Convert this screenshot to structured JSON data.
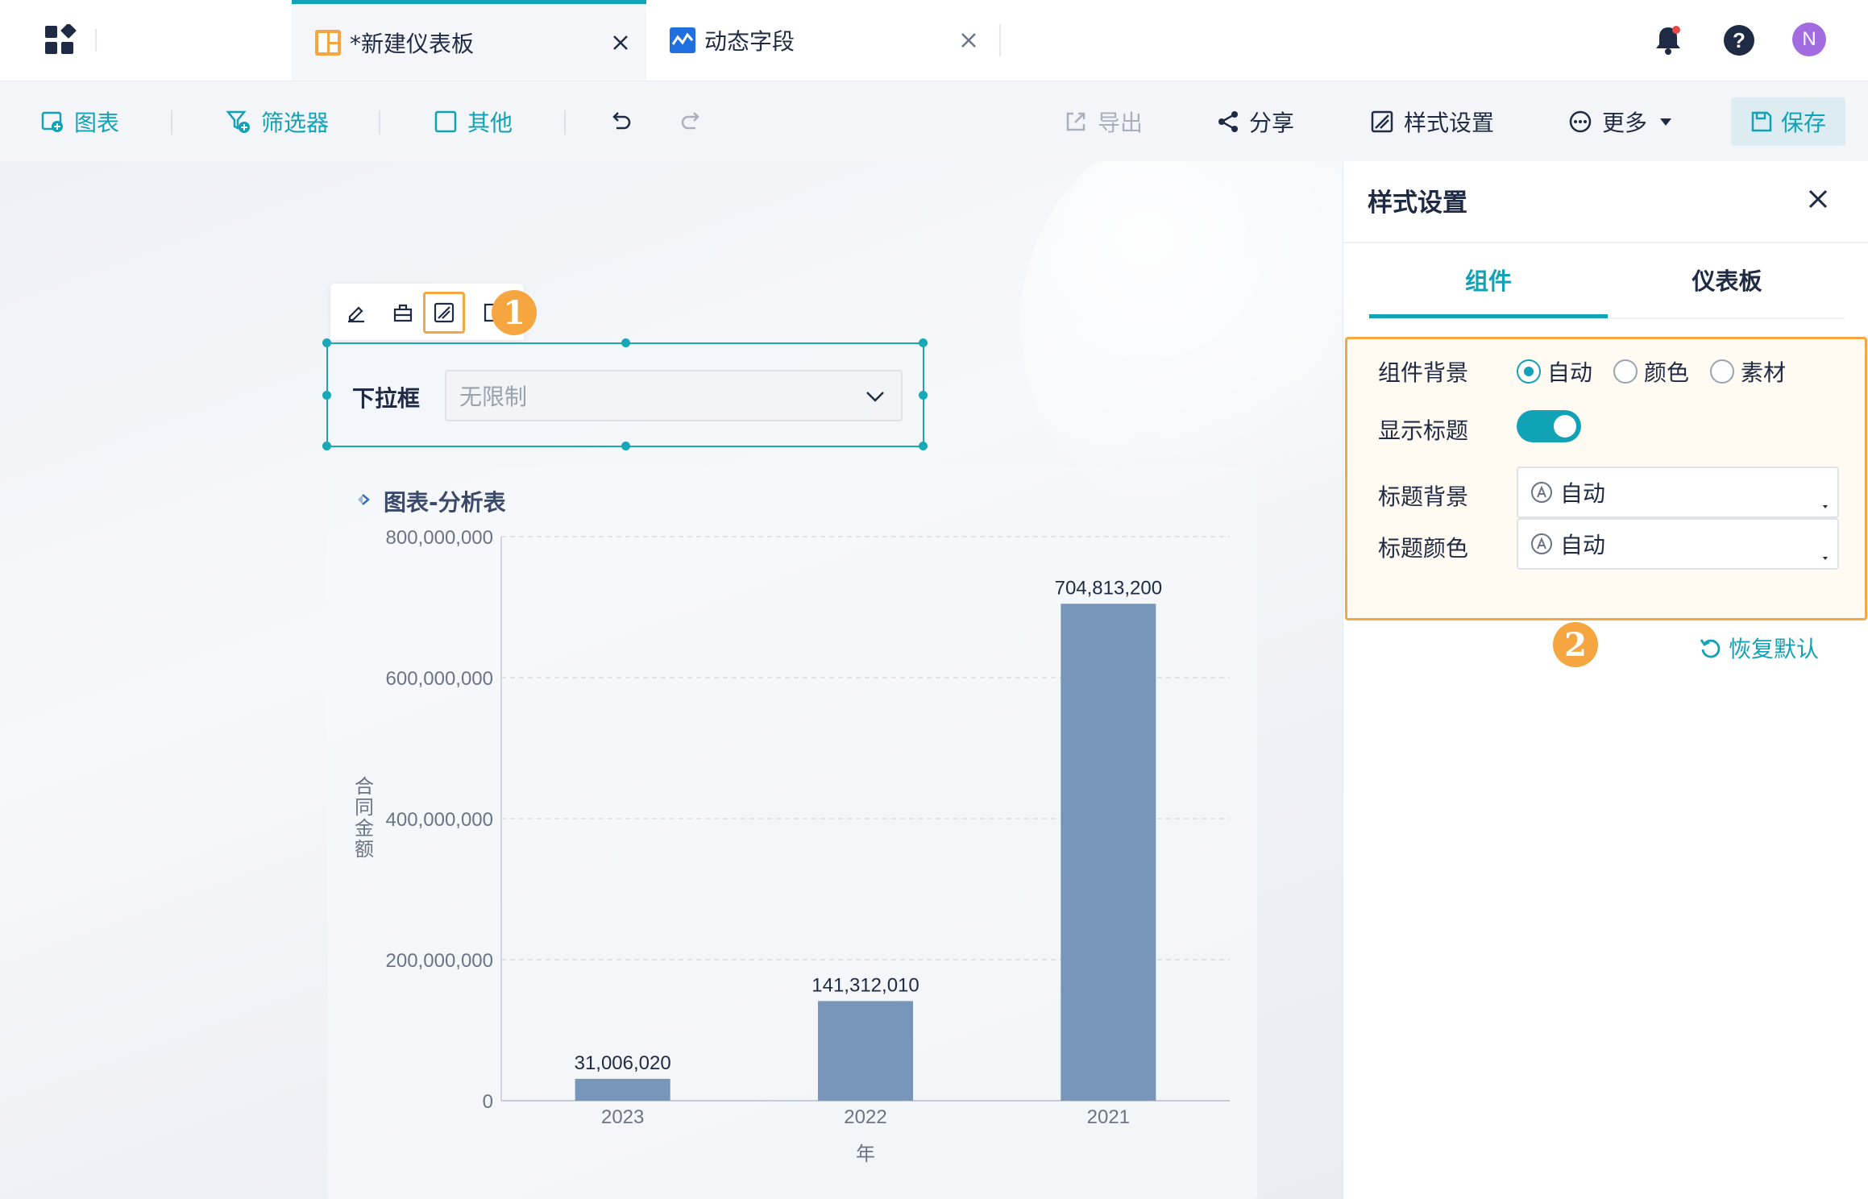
{
  "top_tabs": [
    {
      "label": "*新建仪表板"
    },
    {
      "label": "动态字段"
    }
  ],
  "avatar_initial": "N",
  "toolbar": {
    "chart": "图表",
    "filter": "筛选器",
    "other": "其他",
    "export": "导出",
    "share": "分享",
    "style_settings": "样式设置",
    "more": "更多",
    "save": "保存"
  },
  "callouts": {
    "one": "1",
    "two": "2"
  },
  "filter_widget": {
    "label": "下拉框",
    "placeholder": "无限制"
  },
  "chart_card": {
    "title": "图表-分析表"
  },
  "chart_data": {
    "type": "bar",
    "categories": [
      "2023",
      "2022",
      "2021"
    ],
    "values": [
      31006020,
      141312010,
      704813200
    ],
    "value_labels": [
      "31,006,020",
      "141,312,010",
      "704,813,200"
    ],
    "ylim": [
      0,
      800000000
    ],
    "yticks": [
      {
        "value": 0,
        "label": "0"
      },
      {
        "value": 200000000,
        "label": "200,000,000"
      },
      {
        "value": 400000000,
        "label": "400,000,000"
      },
      {
        "value": 600000000,
        "label": "600,000,000"
      },
      {
        "value": 800000000,
        "label": "800,000,000"
      }
    ],
    "xlabel": "年",
    "ylabel": "合同金额",
    "bar_color": "#7896b9",
    "grid": true
  },
  "panel": {
    "title": "样式设置",
    "tabs": [
      {
        "label": "组件"
      },
      {
        "label": "仪表板"
      }
    ],
    "background": {
      "label": "组件背景",
      "options": [
        "自动",
        "颜色",
        "素材"
      ],
      "selected": "自动"
    },
    "show_title": {
      "label": "显示标题",
      "on": true
    },
    "title_background": {
      "label": "标题背景",
      "value": "自动"
    },
    "title_color": {
      "label": "标题颜色",
      "value": "自动"
    },
    "reset": "恢复默认"
  },
  "colors": {
    "accent": "#12a2b5",
    "callout": "#f5a641",
    "bar": "#7896b9"
  }
}
